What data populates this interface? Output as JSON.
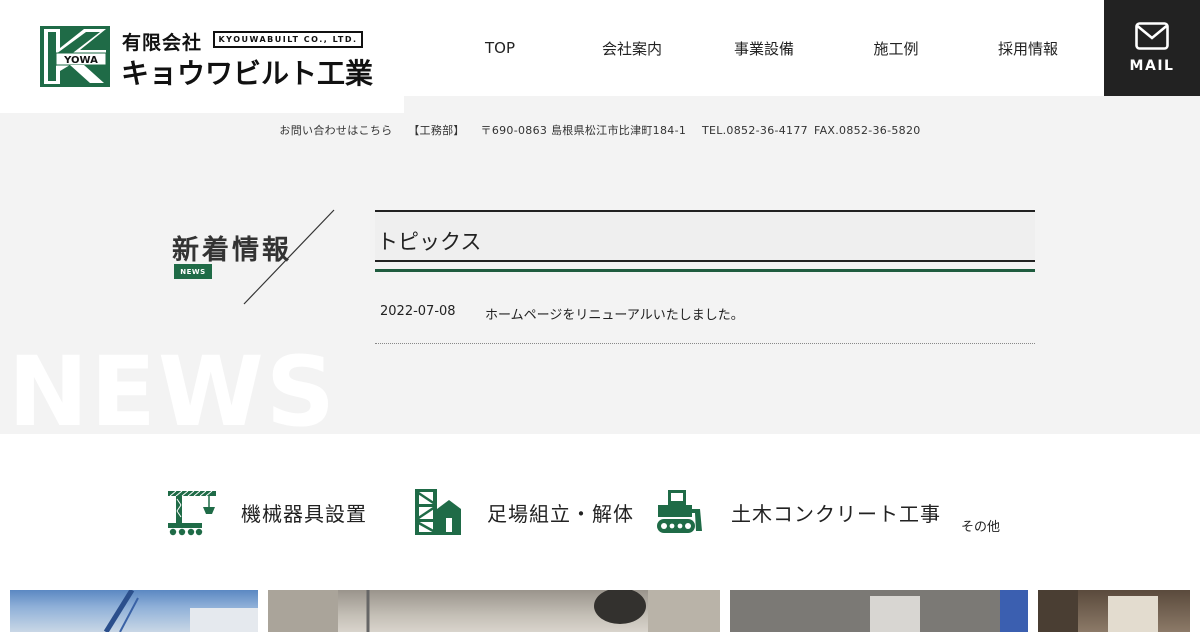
{
  "header": {
    "logo": {
      "mark_text": "YOWA",
      "company_top": "有限会社",
      "company_en": "KYOUWABUILT CO., LTD.",
      "company_main": "キョウワビルト工業"
    },
    "nav": [
      {
        "label": "TOP"
      },
      {
        "label": "会社案内"
      },
      {
        "label": "事業設備"
      },
      {
        "label": "施工例"
      },
      {
        "label": "採用情報"
      }
    ],
    "mail": {
      "label": "MAIL",
      "icon": "envelope-icon"
    }
  },
  "contact": {
    "lead": "お問い合わせはこちら",
    "dept": "【工務部】",
    "address": "〒690-0863 島根県松江市比津町184-1",
    "tel": "TEL.0852-36-4177",
    "fax": "FAX.0852-36-5820"
  },
  "news": {
    "heading": "新着情報",
    "badge": "NEWS",
    "watermark": "NEWS",
    "topics_title": "トピックス",
    "items": [
      {
        "date": "2022-07-08",
        "text": "ホームページをリニューアルいたしました。"
      }
    ]
  },
  "services": {
    "items": [
      {
        "label": "機械器具設置",
        "icon": "crane-icon"
      },
      {
        "label": "足場組立・解体",
        "icon": "scaffold-icon"
      },
      {
        "label": "土木コンクリート工事",
        "icon": "bulldozer-icon"
      }
    ],
    "other": "その他"
  },
  "colors": {
    "brand_green": "#1f6b47",
    "dark": "#222222",
    "band_gray": "#f3f3f3"
  }
}
